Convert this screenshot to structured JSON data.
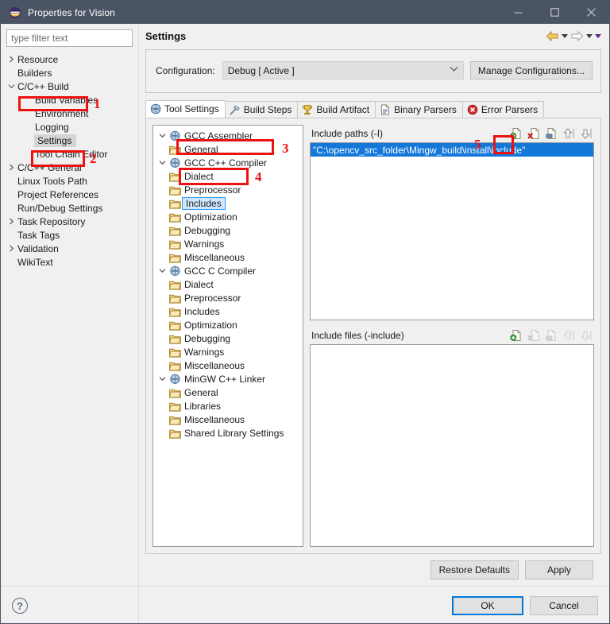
{
  "window": {
    "title": "Properties for Vision",
    "app_icon": "eclipse-icon",
    "minimize": "—",
    "maximize": "□",
    "close": "✕"
  },
  "filter": {
    "placeholder": "type filter text",
    "value": ""
  },
  "sidebar": {
    "items": [
      {
        "label": "Resource",
        "indent": 0,
        "arrow": "collapsed",
        "selected": false
      },
      {
        "label": "Builders",
        "indent": 0,
        "arrow": "none",
        "selected": false
      },
      {
        "label": "C/C++ Build",
        "indent": 0,
        "arrow": "expanded",
        "selected": false
      },
      {
        "label": "Build Variables",
        "indent": 1,
        "arrow": "none",
        "selected": false
      },
      {
        "label": "Environment",
        "indent": 1,
        "arrow": "none",
        "selected": false
      },
      {
        "label": "Logging",
        "indent": 1,
        "arrow": "none",
        "selected": false
      },
      {
        "label": "Settings",
        "indent": 1,
        "arrow": "none",
        "selected": true
      },
      {
        "label": "Tool Chain Editor",
        "indent": 1,
        "arrow": "none",
        "selected": false
      },
      {
        "label": "C/C++ General",
        "indent": 0,
        "arrow": "collapsed",
        "selected": false
      },
      {
        "label": "Linux Tools Path",
        "indent": 0,
        "arrow": "none",
        "selected": false
      },
      {
        "label": "Project References",
        "indent": 0,
        "arrow": "none",
        "selected": false
      },
      {
        "label": "Run/Debug Settings",
        "indent": 0,
        "arrow": "none",
        "selected": false
      },
      {
        "label": "Task Repository",
        "indent": 0,
        "arrow": "collapsed",
        "selected": false
      },
      {
        "label": "Task Tags",
        "indent": 0,
        "arrow": "none",
        "selected": false
      },
      {
        "label": "Validation",
        "indent": 0,
        "arrow": "collapsed",
        "selected": false
      },
      {
        "label": "WikiText",
        "indent": 0,
        "arrow": "none",
        "selected": false
      }
    ],
    "help_icon": "question-mark-icon"
  },
  "header": {
    "title": "Settings",
    "back_icon": "back-arrow-icon",
    "forward_icon": "forward-arrow-icon",
    "menu_icon": "chevron-down-icon"
  },
  "config": {
    "label": "Configuration:",
    "value": "Debug  [ Active ]",
    "caret": "⌄",
    "manage_button": "Manage Configurations..."
  },
  "tabs": [
    {
      "label": "Tool Settings",
      "icon": "globe-icon",
      "active": true
    },
    {
      "label": "Build Steps",
      "icon": "hammer-icon",
      "active": false
    },
    {
      "label": "Build Artifact",
      "icon": "trophy-icon",
      "active": false
    },
    {
      "label": "Binary Parsers",
      "icon": "page-icon",
      "active": false
    },
    {
      "label": "Error Parsers",
      "icon": "error-icon",
      "active": false
    }
  ],
  "tool_tree": [
    {
      "label": "GCC Assembler",
      "level": 0,
      "twist": "expanded",
      "icon": "tool-icon",
      "selected": false
    },
    {
      "label": "General",
      "level": 1,
      "twist": "none",
      "icon": "folder-icon",
      "selected": false
    },
    {
      "label": "GCC C++ Compiler",
      "level": 0,
      "twist": "expanded",
      "icon": "tool-icon",
      "selected": false
    },
    {
      "label": "Dialect",
      "level": 1,
      "twist": "none",
      "icon": "folder-icon",
      "selected": false
    },
    {
      "label": "Preprocessor",
      "level": 1,
      "twist": "none",
      "icon": "folder-icon",
      "selected": false
    },
    {
      "label": "Includes",
      "level": 1,
      "twist": "none",
      "icon": "folder-icon",
      "selected": true
    },
    {
      "label": "Optimization",
      "level": 1,
      "twist": "none",
      "icon": "folder-icon",
      "selected": false
    },
    {
      "label": "Debugging",
      "level": 1,
      "twist": "none",
      "icon": "folder-icon",
      "selected": false
    },
    {
      "label": "Warnings",
      "level": 1,
      "twist": "none",
      "icon": "folder-icon",
      "selected": false
    },
    {
      "label": "Miscellaneous",
      "level": 1,
      "twist": "none",
      "icon": "folder-icon",
      "selected": false
    },
    {
      "label": "GCC C Compiler",
      "level": 0,
      "twist": "expanded",
      "icon": "tool-icon",
      "selected": false
    },
    {
      "label": "Dialect",
      "level": 1,
      "twist": "none",
      "icon": "folder-icon",
      "selected": false
    },
    {
      "label": "Preprocessor",
      "level": 1,
      "twist": "none",
      "icon": "folder-icon",
      "selected": false
    },
    {
      "label": "Includes",
      "level": 1,
      "twist": "none",
      "icon": "folder-icon",
      "selected": false
    },
    {
      "label": "Optimization",
      "level": 1,
      "twist": "none",
      "icon": "folder-icon",
      "selected": false
    },
    {
      "label": "Debugging",
      "level": 1,
      "twist": "none",
      "icon": "folder-icon",
      "selected": false
    },
    {
      "label": "Warnings",
      "level": 1,
      "twist": "none",
      "icon": "folder-icon",
      "selected": false
    },
    {
      "label": "Miscellaneous",
      "level": 1,
      "twist": "none",
      "icon": "folder-icon",
      "selected": false
    },
    {
      "label": "MinGW C++ Linker",
      "level": 0,
      "twist": "expanded",
      "icon": "tool-icon",
      "selected": false
    },
    {
      "label": "General",
      "level": 1,
      "twist": "none",
      "icon": "folder-icon",
      "selected": false
    },
    {
      "label": "Libraries",
      "level": 1,
      "twist": "none",
      "icon": "folder-icon",
      "selected": false
    },
    {
      "label": "Miscellaneous",
      "level": 1,
      "twist": "none",
      "icon": "folder-icon",
      "selected": false
    },
    {
      "label": "Shared Library Settings",
      "level": 1,
      "twist": "none",
      "icon": "folder-icon",
      "selected": false
    }
  ],
  "include_paths": {
    "title": "Include paths (-I)",
    "toolbar": [
      {
        "name": "add-icon",
        "enabled": true
      },
      {
        "name": "delete-icon",
        "enabled": true
      },
      {
        "name": "edit-icon",
        "enabled": true
      },
      {
        "name": "move-up-icon",
        "enabled": true
      },
      {
        "name": "move-down-icon",
        "enabled": true
      }
    ],
    "rows": [
      {
        "value": "\"C:\\opencv_src_folder\\Mingw_build\\install\\include\"",
        "selected": true
      }
    ]
  },
  "include_files": {
    "title": "Include files (-include)",
    "toolbar": [
      {
        "name": "add-icon",
        "enabled": true
      },
      {
        "name": "delete-icon",
        "enabled": false
      },
      {
        "name": "edit-icon",
        "enabled": false
      },
      {
        "name": "move-up-icon",
        "enabled": false
      },
      {
        "name": "move-down-icon",
        "enabled": false
      }
    ],
    "rows": []
  },
  "buttons": {
    "restore_defaults": "Restore Defaults",
    "apply": "Apply",
    "ok": "OK",
    "cancel": "Cancel"
  },
  "annotations": [
    {
      "number": "1",
      "target": "sidebar-item-c-cpp-build"
    },
    {
      "number": "2",
      "target": "sidebar-item-settings"
    },
    {
      "number": "3",
      "target": "tool-tree-gcc-cpp-compiler"
    },
    {
      "number": "4",
      "target": "tool-tree-includes"
    },
    {
      "number": "5",
      "target": "include-paths-add-button"
    }
  ],
  "colors": {
    "titlebar": "#4a5464",
    "selection_blue": "#1378d8",
    "annotation_red": "#ee1111",
    "accent_focus": "#0078d7"
  }
}
